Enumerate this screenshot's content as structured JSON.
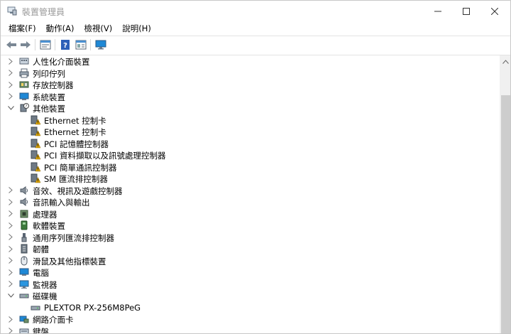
{
  "window": {
    "title": "裝置管理員",
    "minimize_glyph": "—",
    "maximize_glyph": "☐",
    "close_glyph": "✕"
  },
  "menu": [
    "檔案(F)",
    "動作(A)",
    "檢視(V)",
    "說明(H)"
  ],
  "toolbar": {
    "icons": [
      "back-arrow-icon",
      "forward-arrow-icon",
      "properties-icon",
      "help-icon",
      "details-icon",
      "monitor-scan-icon"
    ]
  },
  "tree": [
    {
      "label": "人性化介面裝置",
      "icon": "hid-icon",
      "depth": 0,
      "state": "collapsed"
    },
    {
      "label": "列印佇列",
      "icon": "printer-icon",
      "depth": 0,
      "state": "collapsed"
    },
    {
      "label": "存放控制器",
      "icon": "storage-controller-icon",
      "depth": 0,
      "state": "collapsed"
    },
    {
      "label": "系統裝置",
      "icon": "system-device-icon",
      "depth": 0,
      "state": "collapsed"
    },
    {
      "label": "其他裝置",
      "icon": "other-device-icon",
      "depth": 0,
      "state": "expanded"
    },
    {
      "label": "Ethernet 控制卡",
      "icon": "warning-device-icon",
      "depth": 1,
      "state": "leaf"
    },
    {
      "label": "Ethernet 控制卡",
      "icon": "warning-device-icon",
      "depth": 1,
      "state": "leaf"
    },
    {
      "label": "PCI 記憶體控制器",
      "icon": "warning-device-icon",
      "depth": 1,
      "state": "leaf"
    },
    {
      "label": "PCI 資料擷取以及訊號處理控制器",
      "icon": "warning-device-icon",
      "depth": 1,
      "state": "leaf"
    },
    {
      "label": "PCI 簡單通訊控制器",
      "icon": "warning-device-icon",
      "depth": 1,
      "state": "leaf"
    },
    {
      "label": "SM 匯流排控制器",
      "icon": "warning-device-icon",
      "depth": 1,
      "state": "leaf"
    },
    {
      "label": "音效、視訊及遊戲控制器",
      "icon": "speaker-icon",
      "depth": 0,
      "state": "collapsed"
    },
    {
      "label": "音訊輸入與輸出",
      "icon": "speaker-icon",
      "depth": 0,
      "state": "collapsed"
    },
    {
      "label": "處理器",
      "icon": "processor-icon",
      "depth": 0,
      "state": "collapsed"
    },
    {
      "label": "軟體裝置",
      "icon": "software-device-icon",
      "depth": 0,
      "state": "collapsed"
    },
    {
      "label": "通用序列匯流排控制器",
      "icon": "usb-icon",
      "depth": 0,
      "state": "collapsed"
    },
    {
      "label": "韌體",
      "icon": "firmware-icon",
      "depth": 0,
      "state": "collapsed"
    },
    {
      "label": "滑鼠及其他指標裝置",
      "icon": "mouse-icon",
      "depth": 0,
      "state": "collapsed"
    },
    {
      "label": "電腦",
      "icon": "computer-icon",
      "depth": 0,
      "state": "collapsed"
    },
    {
      "label": "監視器",
      "icon": "monitor-icon",
      "depth": 0,
      "state": "collapsed"
    },
    {
      "label": "磁碟機",
      "icon": "disk-drive-icon",
      "depth": 0,
      "state": "expanded"
    },
    {
      "label": "PLEXTOR PX-256M8PeG",
      "icon": "disk-drive-icon",
      "depth": 1,
      "state": "leaf"
    },
    {
      "label": "網路介面卡",
      "icon": "network-adapter-icon",
      "depth": 0,
      "state": "collapsed"
    },
    {
      "label": "鍵盤",
      "icon": "keyboard-icon",
      "depth": 0,
      "state": "collapsed"
    }
  ],
  "colors": {
    "warning": "#f0b400",
    "accent_blue": "#1e88d6",
    "scroll_thumb": "#cdcdcd"
  }
}
